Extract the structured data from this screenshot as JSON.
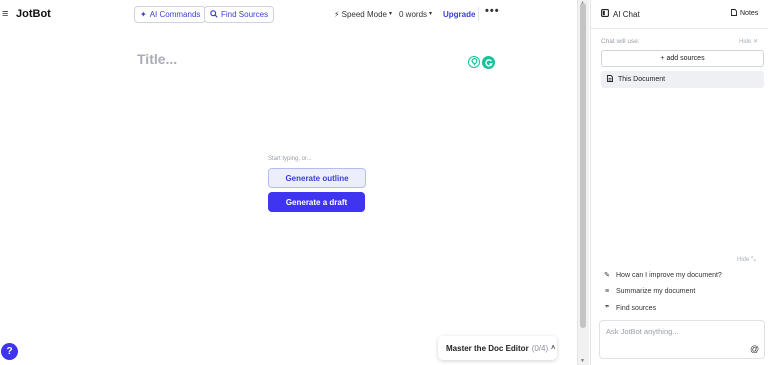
{
  "brand": {
    "menu_icon": "≡",
    "name": "JotBot"
  },
  "toolbar": {
    "ai_commands": "AI Commands",
    "find_sources": "Find Sources",
    "speed_mode": "Speed Mode",
    "word_count": "0 words",
    "upgrade": "Upgrade",
    "more": "•••"
  },
  "editor": {
    "title_placeholder": "Title...",
    "start_hint": "Start typing, or...",
    "generate_outline": "Generate outline",
    "generate_draft": "Generate a draft"
  },
  "help": {
    "label": "?"
  },
  "tour": {
    "label": "Master the Doc Editor",
    "progress": "(0/4)"
  },
  "chat": {
    "title": "AI Chat",
    "notes": "Notes",
    "chat_will_use": "Chat will use:",
    "hide": "Hide",
    "add_sources": "+ add sources",
    "this_document": "This Document",
    "suggestions": [
      {
        "icon": "magic-wand-icon",
        "label": "How can I improve my document?"
      },
      {
        "icon": "lines-icon",
        "label": "Summarize my document"
      },
      {
        "icon": "quote-icon",
        "label": "Find sources"
      }
    ],
    "input_placeholder": "Ask JotBot anything...",
    "mention": "@"
  },
  "colors": {
    "accent": "#3f34f0",
    "accent_text": "#3a3fd6",
    "grammarly": "#15c39a",
    "muted": "#9aa0a6"
  }
}
